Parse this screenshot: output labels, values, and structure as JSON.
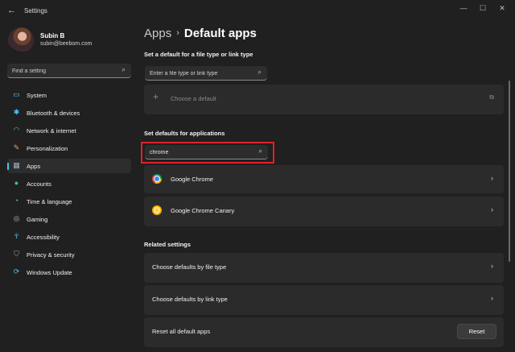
{
  "window": {
    "title": "Settings",
    "back_glyph": "←",
    "minimize_glyph": "—",
    "maximize_glyph": "☐",
    "close_glyph": "✕"
  },
  "user": {
    "name": "Subin B",
    "email": "subin@beebom.com"
  },
  "sidebar": {
    "search_placeholder": "Find a setting",
    "items": [
      {
        "label": "System",
        "icon": "monitor-icon",
        "glyph": "▭",
        "color": "#4cc2ff"
      },
      {
        "label": "Bluetooth & devices",
        "icon": "bluetooth-icon",
        "glyph": "✱",
        "color": "#4cc2ff"
      },
      {
        "label": "Network & internet",
        "icon": "wifi-icon",
        "glyph": "◠",
        "color": "#4cc2ff"
      },
      {
        "label": "Personalization",
        "icon": "brush-icon",
        "glyph": "✎",
        "color": "#e0a36b"
      },
      {
        "label": "Apps",
        "icon": "apps-icon",
        "glyph": "▦",
        "color": "#9fb4c8"
      },
      {
        "label": "Accounts",
        "icon": "person-icon",
        "glyph": "●",
        "color": "#3fbf9f"
      },
      {
        "label": "Time & language",
        "icon": "globe-clock-icon",
        "glyph": "◔",
        "color": "#4cc2ff"
      },
      {
        "label": "Gaming",
        "icon": "gamepad-icon",
        "glyph": "◎",
        "color": "#b8b8b8"
      },
      {
        "label": "Accessibility",
        "icon": "accessibility-icon",
        "glyph": "☥",
        "color": "#4cc2ff"
      },
      {
        "label": "Privacy & security",
        "icon": "shield-icon",
        "glyph": "⛉",
        "color": "#9aa4b0"
      },
      {
        "label": "Windows Update",
        "icon": "update-icon",
        "glyph": "⟳",
        "color": "#4cc2ff"
      }
    ],
    "active_index": 4
  },
  "breadcrumb": {
    "parent": "Apps",
    "separator": "›",
    "current": "Default apps"
  },
  "file_type_section": {
    "heading": "Set a default for a file type or link type",
    "search_placeholder": "Enter a file type or link type",
    "choose_default_label": "Choose a default",
    "plus_glyph": "+",
    "external_glyph": "⧉"
  },
  "applications_section": {
    "heading": "Set defaults for applications",
    "search_value": "chrome",
    "results": [
      {
        "label": "Google Chrome",
        "icon": "google-chrome-icon"
      },
      {
        "label": "Google Chrome Canary",
        "icon": "google-chrome-canary-icon"
      }
    ]
  },
  "related_settings": {
    "heading": "Related settings",
    "items": [
      {
        "label": "Choose defaults by file type"
      },
      {
        "label": "Choose defaults by link type"
      }
    ],
    "reset_label": "Reset all default apps",
    "reset_button": "Reset"
  },
  "glyphs": {
    "search": "⌕",
    "chevron_right": "›"
  },
  "colors": {
    "accent": "#4cc2ff",
    "highlight_border": "#e0222b",
    "background": "#202020",
    "card": "#2b2b2b"
  }
}
